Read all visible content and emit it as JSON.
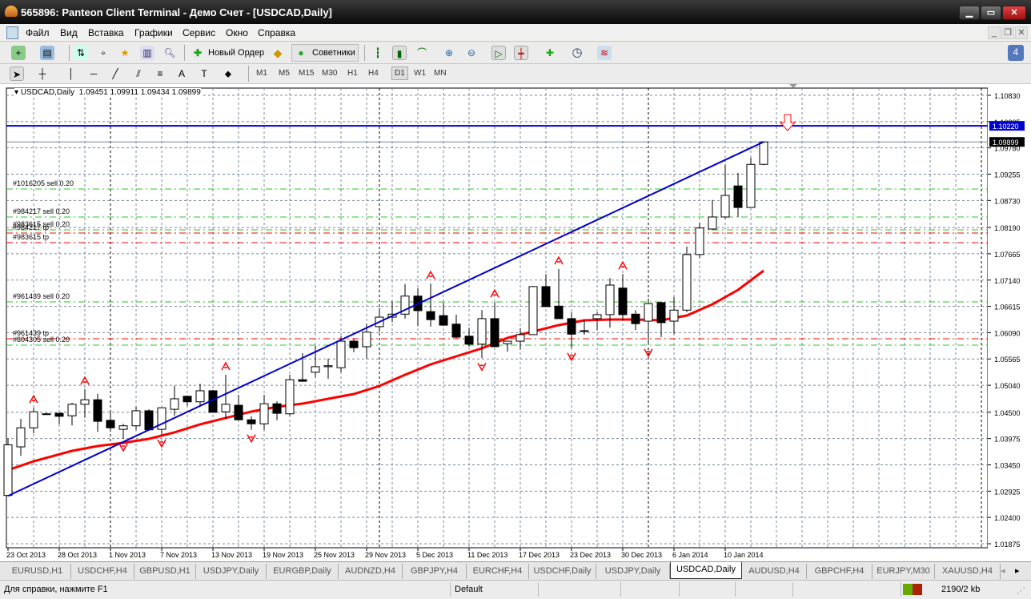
{
  "window": {
    "title": "565896: Panteon Client Terminal - Демо Счет - [USDCAD,Daily]",
    "controls": [
      "minimize",
      "maximize",
      "close"
    ]
  },
  "menu": [
    "Файл",
    "Вид",
    "Вставка",
    "Графики",
    "Сервис",
    "Окно",
    "Справка"
  ],
  "toolbar1": {
    "new_order": "Новый Ордер",
    "experts": "Советники",
    "notification_count": "4"
  },
  "timeframes": [
    "M1",
    "M5",
    "M15",
    "M30",
    "H1",
    "H4",
    "D1",
    "W1",
    "MN"
  ],
  "active_timeframe": "D1",
  "colors": {
    "bull": "#ffffff",
    "bear": "#000000",
    "trendline": "#0000cc",
    "level": "#0000cc",
    "ma": "#ff0000",
    "sell_line": "#22cc22",
    "tp_line": "#ff0000",
    "grid": "#778899",
    "bid_badge": "#000000",
    "level_badge": "#0000cc"
  },
  "chart_data": {
    "type": "candlestick",
    "symbol_header": "USDCAD,Daily",
    "ohlc_header": "1.09451 1.09911 1.09434 1.09899",
    "ylim": [
      1.01875,
      1.1083
    ],
    "y_ticks": [
      "1.10830",
      "1.10305",
      "1.09780",
      "1.09255",
      "1.08730",
      "1.08190",
      "1.07665",
      "1.07140",
      "1.06615",
      "1.06090",
      "1.05565",
      "1.05040",
      "1.04500",
      "1.03975",
      "1.03450",
      "1.02925",
      "1.02400",
      "1.01875"
    ],
    "x_labels": [
      {
        "i": 0,
        "label": "23 Oct 2013"
      },
      {
        "i": 4,
        "label": "28 Oct 2013"
      },
      {
        "i": 8,
        "label": "1 Nov 2013"
      },
      {
        "i": 12,
        "label": "7 Nov 2013"
      },
      {
        "i": 16,
        "label": "13 Nov 2013"
      },
      {
        "i": 20,
        "label": "19 Nov 2013"
      },
      {
        "i": 24,
        "label": "25 Nov 2013"
      },
      {
        "i": 28,
        "label": "29 Nov 2013"
      },
      {
        "i": 32,
        "label": "5 Dec 2013"
      },
      {
        "i": 36,
        "label": "11 Dec 2013"
      },
      {
        "i": 40,
        "label": "17 Dec 2013"
      },
      {
        "i": 44,
        "label": "23 Dec 2013"
      },
      {
        "i": 48,
        "label": "30 Dec 2013"
      },
      {
        "i": 52,
        "label": "6 Jan 2014"
      },
      {
        "i": 56,
        "label": "10 Jan 2014"
      }
    ],
    "candles": [
      [
        1.0284,
        1.0398,
        1.0282,
        1.0385
      ],
      [
        1.0381,
        1.0437,
        1.0363,
        1.0419
      ],
      [
        1.0419,
        1.0459,
        1.0408,
        1.0451
      ],
      [
        1.0447,
        1.0449,
        1.0445,
        1.0447
      ],
      [
        1.0448,
        1.0449,
        1.0426,
        1.0442
      ],
      [
        1.0443,
        1.0469,
        1.0424,
        1.0466
      ],
      [
        1.0466,
        1.0496,
        1.0439,
        1.0475
      ],
      [
        1.0475,
        1.0487,
        1.0411,
        1.0432
      ],
      [
        1.0434,
        1.0453,
        1.0411,
        1.0419
      ],
      [
        1.0416,
        1.0427,
        1.0397,
        1.0423
      ],
      [
        1.0423,
        1.0461,
        1.0415,
        1.0453
      ],
      [
        1.0453,
        1.0456,
        1.0415,
        1.0415
      ],
      [
        1.0416,
        1.0459,
        1.0405,
        1.0459
      ],
      [
        1.0456,
        1.0503,
        1.0443,
        1.0477
      ],
      [
        1.0482,
        1.0483,
        1.0463,
        1.0471
      ],
      [
        1.0471,
        1.0507,
        1.0463,
        1.0493
      ],
      [
        1.0493,
        1.0495,
        1.045,
        1.045
      ],
      [
        1.0451,
        1.0525,
        1.0437,
        1.0466
      ],
      [
        1.0464,
        1.0485,
        1.0434,
        1.0435
      ],
      [
        1.0435,
        1.0442,
        1.0415,
        1.0427
      ],
      [
        1.0427,
        1.0485,
        1.0415,
        1.0467
      ],
      [
        1.0467,
        1.0472,
        1.0434,
        1.0448
      ],
      [
        1.0447,
        1.0525,
        1.0443,
        1.0515
      ],
      [
        1.0515,
        1.0568,
        1.0511,
        1.0512
      ],
      [
        1.053,
        1.0583,
        1.052,
        1.0541
      ],
      [
        1.0541,
        1.0557,
        1.0517,
        1.0543
      ],
      [
        1.0539,
        1.0602,
        1.053,
        1.0592
      ],
      [
        1.0592,
        1.0597,
        1.057,
        1.0579
      ],
      [
        1.0581,
        1.0627,
        1.0557,
        1.061
      ],
      [
        1.0621,
        1.0658,
        1.061,
        1.064
      ],
      [
        1.064,
        1.0672,
        1.063,
        1.0646
      ],
      [
        1.0646,
        1.0706,
        1.0637,
        1.0682
      ],
      [
        1.0682,
        1.0698,
        1.0622,
        1.0653
      ],
      [
        1.0651,
        1.0707,
        1.0621,
        1.0635
      ],
      [
        1.0643,
        1.0669,
        1.0622,
        1.0624
      ],
      [
        1.0626,
        1.0645,
        1.0598,
        1.06
      ],
      [
        1.0602,
        1.0619,
        1.0581,
        1.0586
      ],
      [
        1.0586,
        1.0654,
        1.0558,
        1.0637
      ],
      [
        1.0637,
        1.067,
        1.0581,
        1.0581
      ],
      [
        1.0587,
        1.0592,
        1.0571,
        1.0592
      ],
      [
        1.0592,
        1.0618,
        1.0575,
        1.0605
      ],
      [
        1.0605,
        1.0702,
        1.0605,
        1.0701
      ],
      [
        1.0701,
        1.0726,
        1.0661,
        1.0661
      ],
      [
        1.0662,
        1.0736,
        1.0637,
        1.0637
      ],
      [
        1.0637,
        1.065,
        1.0578,
        1.0606
      ],
      [
        1.0613,
        1.0634,
        1.0605,
        1.0613
      ],
      [
        1.0637,
        1.065,
        1.0614,
        1.0645
      ],
      [
        1.0645,
        1.0718,
        1.0619,
        1.0704
      ],
      [
        1.0698,
        1.0726,
        1.0634,
        1.0645
      ],
      [
        1.0646,
        1.0654,
        1.0614,
        1.0627
      ],
      [
        1.0632,
        1.0677,
        1.0586,
        1.0667
      ],
      [
        1.0669,
        1.0671,
        1.06,
        1.0629
      ],
      [
        1.0632,
        1.068,
        1.0606,
        1.0654
      ],
      [
        1.0654,
        1.0781,
        1.065,
        1.0765
      ],
      [
        1.0765,
        1.0829,
        1.0758,
        1.0818
      ],
      [
        1.0816,
        1.0874,
        1.0814,
        1.084
      ],
      [
        1.084,
        1.0945,
        1.0837,
        1.0883
      ],
      [
        1.0902,
        1.0928,
        1.084,
        1.0859
      ],
      [
        1.0859,
        1.0958,
        1.0859,
        1.0945
      ],
      [
        1.09451,
        1.09911,
        1.09434,
        1.09899
      ]
    ],
    "ma": [
      [
        0,
        1.03346
      ],
      [
        2,
        1.03522
      ],
      [
        5,
        1.0373
      ],
      [
        7,
        1.03826
      ],
      [
        9,
        1.0389
      ],
      [
        11,
        1.0397
      ],
      [
        13,
        1.04098
      ],
      [
        15,
        1.04258
      ],
      [
        17,
        1.04386
      ],
      [
        19,
        1.04514
      ],
      [
        21,
        1.0461
      ],
      [
        23,
        1.04673
      ],
      [
        25,
        1.04769
      ],
      [
        27,
        1.04865
      ],
      [
        29,
        1.05025
      ],
      [
        31,
        1.05249
      ],
      [
        33,
        1.05457
      ],
      [
        35,
        1.05617
      ],
      [
        37,
        1.05777
      ],
      [
        39,
        1.05985
      ],
      [
        41,
        1.06113
      ],
      [
        43,
        1.06241
      ],
      [
        45,
        1.06337
      ],
      [
        47,
        1.06353
      ],
      [
        49,
        1.06353
      ],
      [
        51,
        1.06337
      ],
      [
        53,
        1.06432
      ],
      [
        55,
        1.06656
      ],
      [
        57,
        1.06944
      ],
      [
        59,
        1.07328
      ]
    ],
    "trendline": [
      [
        0,
        1.0283
      ],
      [
        59,
        1.099
      ]
    ],
    "horizontal_level": {
      "price": 1.1022,
      "label": "1.10220"
    },
    "bid": {
      "price": 1.09899,
      "label": "1.09899"
    },
    "orders": [
      {
        "label": "#1016205 sell 0.20",
        "price": 1.08959,
        "kind": "sell"
      },
      {
        "label": "#984217 sell 0.20",
        "price": 1.08399,
        "kind": "sell"
      },
      {
        "label": "#983615 sell 0.20",
        "price": 1.08143,
        "kind": "sell"
      },
      {
        "label": "#984217 tp",
        "price": 1.0808,
        "kind": "tp"
      },
      {
        "label": "#983615 tp",
        "price": 1.07888,
        "kind": "tp"
      },
      {
        "label": "#961439 sell 0.20",
        "price": 1.06704,
        "kind": "sell"
      },
      {
        "label": "#961439 tp",
        "price": 1.05969,
        "kind": "tp"
      },
      {
        "label": "#804305 sell 0.20",
        "price": 1.05841,
        "kind": "sell"
      }
    ],
    "fractals_up": [
      2,
      6,
      17,
      33,
      38,
      43,
      48
    ],
    "fractals_down": [
      9,
      12,
      19,
      37,
      44,
      50
    ],
    "period_separators": [
      8,
      29,
      50,
      76
    ]
  },
  "tabs": [
    "EURUSD,H1",
    "USDCHF,H4",
    "GBPUSD,H1",
    "USDJPY,Daily",
    "EURGBP,Daily",
    "AUDNZD,H4",
    "GBPJPY,H4",
    "EURCHF,H4",
    "USDCHF,Daily",
    "USDJPY,Daily",
    "USDCAD,Daily",
    "AUDUSD,H4",
    "GBPCHF,H4",
    "EURJPY,M30",
    "XAUUSD,H4"
  ],
  "active_tab": "USDCAD,Daily",
  "status": {
    "help": "Для справки, нажмите F1",
    "profile": "Default",
    "traffic": "2190/2 kb"
  }
}
